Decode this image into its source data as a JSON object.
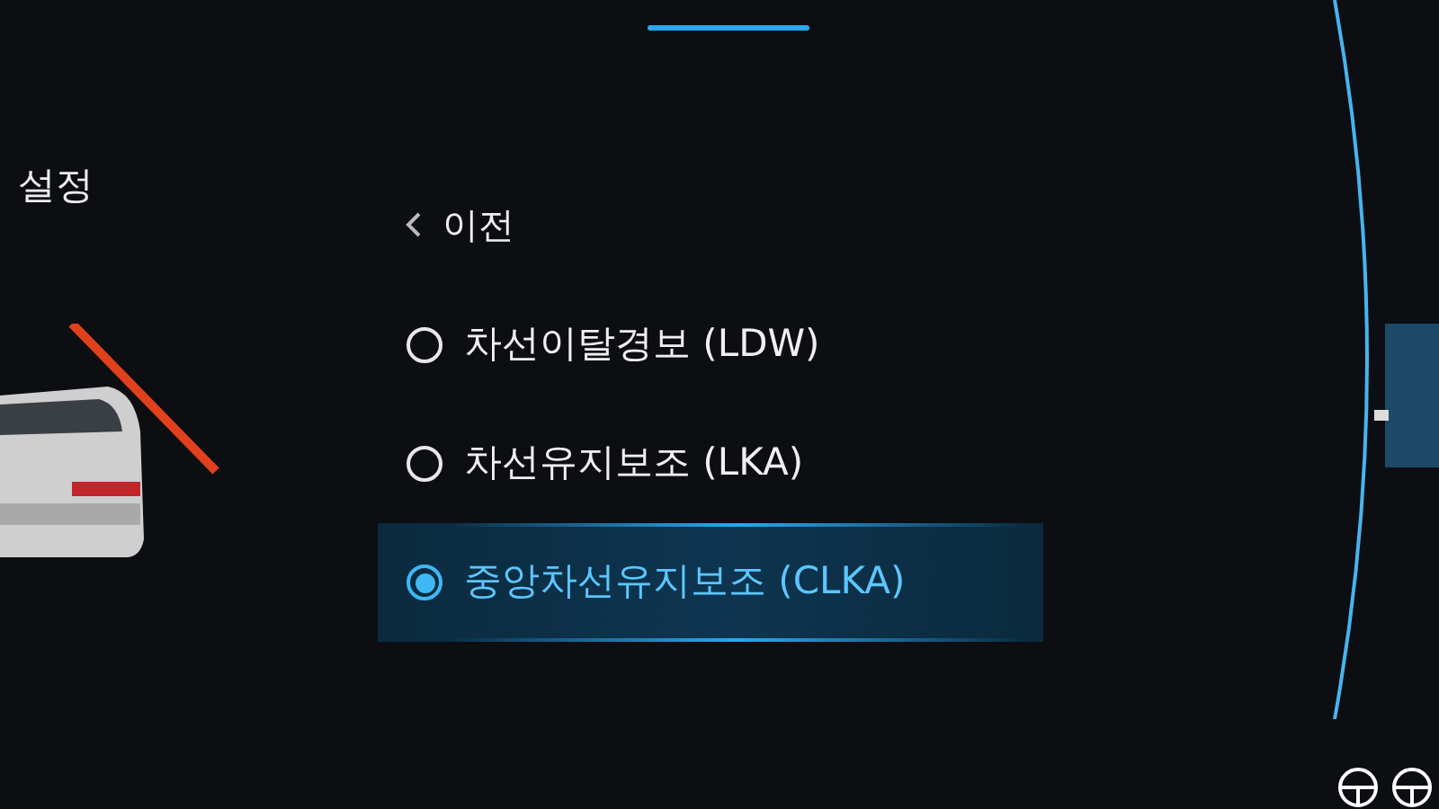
{
  "title": "설정",
  "back": {
    "label": "이전"
  },
  "options": [
    {
      "label": "차선이탈경보 (LDW)",
      "selected": false
    },
    {
      "label": "차선유지보조 (LKA)",
      "selected": false
    },
    {
      "label": "중앙차선유지보조 (CLKA)",
      "selected": true
    }
  ]
}
